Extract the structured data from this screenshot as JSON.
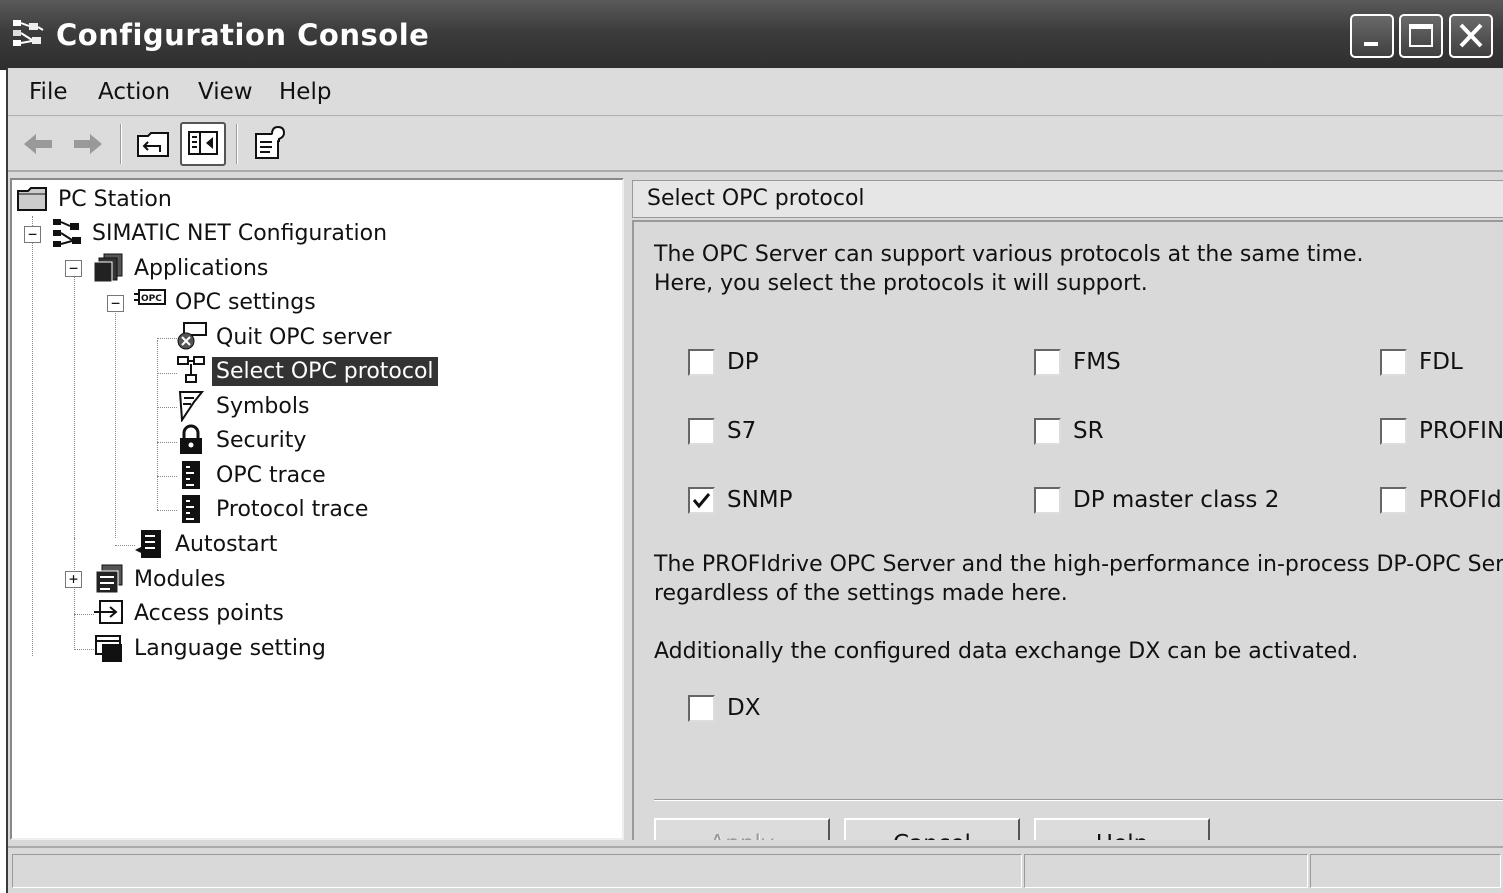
{
  "window": {
    "title": "Configuration  Console",
    "icon": "network-console-icon",
    "controls": [
      "minimize",
      "maximize",
      "close"
    ]
  },
  "menubar": {
    "items": [
      "File",
      "Action",
      "View",
      "Help"
    ]
  },
  "toolbar": {
    "buttons": [
      "back-arrow-icon",
      "forward-arrow-icon",
      "up-one-level-icon",
      "show-hide-console-tree-icon",
      "properties-help-icon"
    ]
  },
  "tree": {
    "root": "PC Station",
    "simatic": "SIMATIC NET Configuration",
    "applications": "Applications",
    "opc_settings": "OPC settings",
    "quit_opc": "Quit OPC server",
    "select_protocol": "Select OPC protocol",
    "symbols": "Symbols",
    "security": "Security",
    "opc_trace": "OPC trace",
    "protocol_trace": "Protocol trace",
    "autostart": "Autostart",
    "modules": "Modules",
    "access_points": "Access points",
    "language": "Language setting",
    "selected": "Select OPC protocol"
  },
  "panel": {
    "header": "Select OPC protocol",
    "intro_line1": "The OPC Server can support various protocols at the same time.",
    "intro_line2": "Here, you select the protocols it will support.",
    "protocols": [
      {
        "label": "DP",
        "checked": false
      },
      {
        "label": "FMS",
        "checked": false
      },
      {
        "label": "FDL",
        "checked": false
      },
      {
        "label": "S7",
        "checked": false
      },
      {
        "label": "SR",
        "checked": false
      },
      {
        "label": "PROFINET",
        "checked": false
      },
      {
        "label": "SNMP",
        "checked": true
      },
      {
        "label": "DP master class 2",
        "checked": false
      },
      {
        "label": "PROFIdrive",
        "checked": false
      }
    ],
    "note_line1": "The PROFIdrive OPC Server and the high-performance in-process DP-OPC Server",
    "note_line2": "regardless of the settings made here.",
    "dx_text": "Additionally the configured data exchange DX can be activated.",
    "dx": {
      "label": "DX",
      "checked": false
    },
    "buttons": {
      "apply": "Apply",
      "cancel": "Cancel",
      "help": "Help"
    }
  }
}
